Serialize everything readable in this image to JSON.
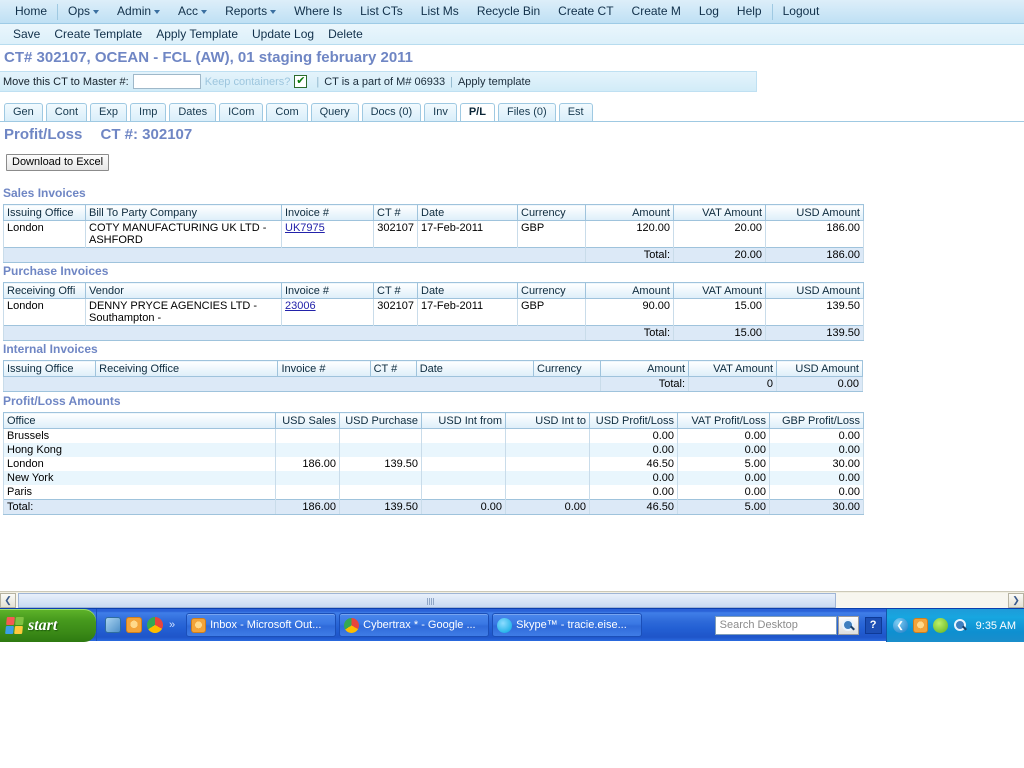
{
  "topnav": {
    "items": [
      {
        "label": "Home",
        "caret": false
      },
      {
        "label": "Ops",
        "caret": true
      },
      {
        "label": "Admin",
        "caret": true
      },
      {
        "label": "Acc",
        "caret": true
      },
      {
        "label": "Reports",
        "caret": true
      },
      {
        "label": "Where Is",
        "caret": false
      },
      {
        "label": "List CTs",
        "caret": false
      },
      {
        "label": "List Ms",
        "caret": false
      },
      {
        "label": "Recycle Bin",
        "caret": false
      },
      {
        "label": "Create CT",
        "caret": false
      },
      {
        "label": "Create M",
        "caret": false
      },
      {
        "label": "Log",
        "caret": false
      },
      {
        "label": "Help",
        "caret": false
      },
      {
        "label": "Logout",
        "caret": false
      }
    ]
  },
  "subnav": {
    "items": [
      {
        "label": "Save"
      },
      {
        "label": "Create Template"
      },
      {
        "label": "Apply Template"
      },
      {
        "label": "Update Log"
      },
      {
        "label": "Delete"
      }
    ]
  },
  "header": {
    "ct_title": "CT# 302107, OCEAN - FCL (AW), 01 staging february 2011"
  },
  "movebar": {
    "move_label": "Move this CT to Master #:",
    "move_input_value": "",
    "keep_containers_label": "Keep containers?",
    "keep_containers_checked": "✔",
    "part_of_label": "CT is a part of M# 06933",
    "apply_template_label": "Apply template"
  },
  "tabs": [
    {
      "label": "Gen",
      "active": false
    },
    {
      "label": "Cont",
      "active": false
    },
    {
      "label": "Exp",
      "active": false
    },
    {
      "label": "Imp",
      "active": false
    },
    {
      "label": "Dates",
      "active": false
    },
    {
      "label": "ICom",
      "active": false
    },
    {
      "label": "Com",
      "active": false
    },
    {
      "label": "Query",
      "active": false
    },
    {
      "label": "Docs (0)",
      "active": false
    },
    {
      "label": "Inv",
      "active": false
    },
    {
      "label": "P/L",
      "active": true
    },
    {
      "label": "Files (0)",
      "active": false
    },
    {
      "label": "Est",
      "active": false
    }
  ],
  "pl": {
    "heading": "Profit/Loss",
    "ct_number_label": "CT #: 302107",
    "download_button": "Download to Excel"
  },
  "sales_invoices": {
    "title": "Sales Invoices",
    "columns": [
      "Issuing Office",
      "Bill To Party Company",
      "Invoice #",
      "CT #",
      "Date",
      "Currency",
      "Amount",
      "VAT Amount",
      "USD Amount"
    ],
    "rows": [
      {
        "office": "London",
        "party": "COTY MANUFACTURING UK LTD - ASHFORD",
        "invoice": "UK7975",
        "ct": "302107",
        "date": "17-Feb-2011",
        "currency": "GBP",
        "amount": "120.00",
        "vat": "20.00",
        "usd": "186.00"
      }
    ],
    "total_label": "Total:",
    "total_vat": "20.00",
    "total_usd": "186.00"
  },
  "purchase_invoices": {
    "title": "Purchase Invoices",
    "columns": [
      "Receiving Offi",
      "Vendor",
      "Invoice #",
      "CT #",
      "Date",
      "Currency",
      "Amount",
      "VAT Amount",
      "USD Amount"
    ],
    "rows": [
      {
        "office": "London",
        "party": "DENNY PRYCE AGENCIES LTD - Southampton -",
        "invoice": "23006",
        "ct": "302107",
        "date": "17-Feb-2011",
        "currency": "GBP",
        "amount": "90.00",
        "vat": "15.00",
        "usd": "139.50"
      }
    ],
    "total_label": "Total:",
    "total_vat": "15.00",
    "total_usd": "139.50"
  },
  "internal_invoices": {
    "title": "Internal Invoices",
    "columns": [
      "Issuing Office",
      "Receiving Office",
      "Invoice #",
      "CT #",
      "Date",
      "Currency",
      "Amount",
      "VAT Amount",
      "USD Amount"
    ],
    "rows": [],
    "total_label": "Total:",
    "total_vat": "0",
    "total_usd": "0.00"
  },
  "profit_loss_amounts": {
    "title": "Profit/Loss Amounts",
    "columns": [
      "Office",
      "USD Sales",
      "USD Purchase",
      "USD Int from",
      "USD Int to",
      "USD Profit/Loss",
      "VAT Profit/Loss",
      "GBP Profit/Loss"
    ],
    "rows": [
      {
        "office": "Brussels",
        "usd_sales": "",
        "usd_purchase": "",
        "usd_int_from": "",
        "usd_int_to": "",
        "usd_pl": "0.00",
        "vat_pl": "0.00",
        "gbp_pl": "0.00"
      },
      {
        "office": "Hong Kong",
        "usd_sales": "",
        "usd_purchase": "",
        "usd_int_from": "",
        "usd_int_to": "",
        "usd_pl": "0.00",
        "vat_pl": "0.00",
        "gbp_pl": "0.00"
      },
      {
        "office": "London",
        "usd_sales": "186.00",
        "usd_purchase": "139.50",
        "usd_int_from": "",
        "usd_int_to": "",
        "usd_pl": "46.50",
        "vat_pl": "5.00",
        "gbp_pl": "30.00"
      },
      {
        "office": "New York",
        "usd_sales": "",
        "usd_purchase": "",
        "usd_int_from": "",
        "usd_int_to": "",
        "usd_pl": "0.00",
        "vat_pl": "0.00",
        "gbp_pl": "0.00"
      },
      {
        "office": "Paris",
        "usd_sales": "",
        "usd_purchase": "",
        "usd_int_from": "",
        "usd_int_to": "",
        "usd_pl": "0.00",
        "vat_pl": "0.00",
        "gbp_pl": "0.00"
      }
    ],
    "total": {
      "office": "Total:",
      "usd_sales": "186.00",
      "usd_purchase": "139.50",
      "usd_int_from": "0.00",
      "usd_int_to": "0.00",
      "usd_pl": "46.50",
      "vat_pl": "5.00",
      "gbp_pl": "30.00"
    }
  },
  "scrollbar": {
    "left_arrow": "❮",
    "right_arrow": "❯"
  },
  "taskbar": {
    "start_label": "start",
    "quicklaunch_overflow": "»",
    "tasks": [
      {
        "label": "Inbox - Microsoft Out...",
        "icon": "outlook-icon"
      },
      {
        "label": "Cybertrax * - Google ...",
        "icon": "chrome-icon"
      },
      {
        "label": "Skype™ - tracie.eise...",
        "icon": "skype-icon"
      }
    ],
    "search_placeholder": "Search Desktop",
    "help_label": "?",
    "tray_chevron": "❮",
    "clock": "9:35 AM"
  }
}
